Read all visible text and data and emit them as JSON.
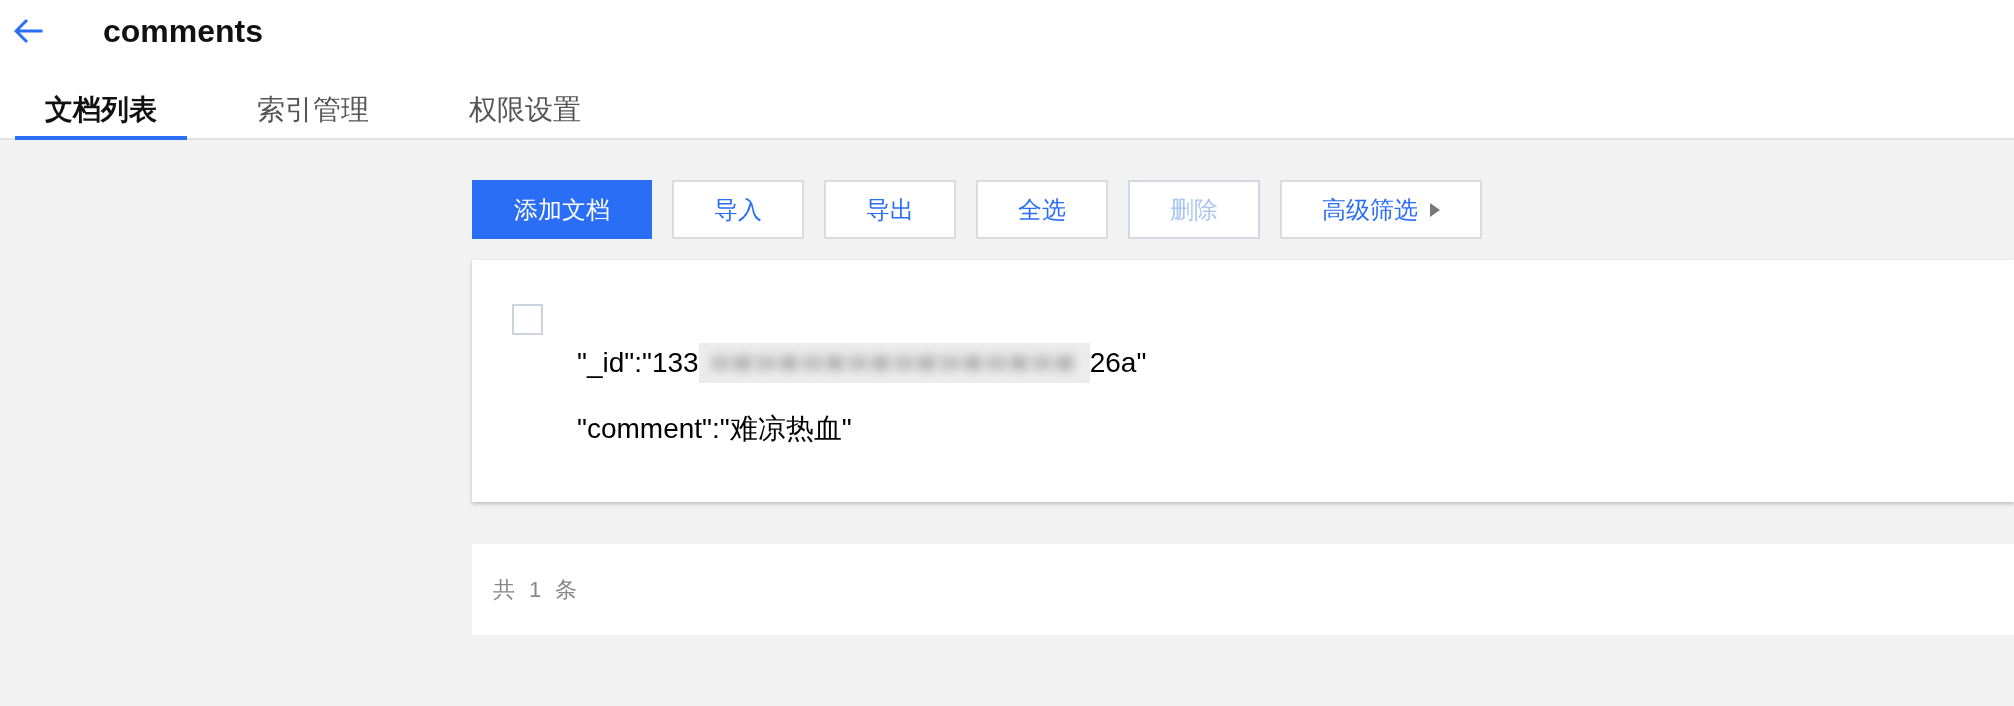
{
  "header": {
    "title": "comments"
  },
  "tabs": [
    {
      "label": "文档列表",
      "selected": true
    },
    {
      "label": "索引管理",
      "selected": false
    },
    {
      "label": "权限设置",
      "selected": false
    }
  ],
  "toolbar": {
    "buttons": [
      {
        "label": "添加文档",
        "kind": "primary",
        "disabled": false
      },
      {
        "label": "导入",
        "kind": "default",
        "disabled": false
      },
      {
        "label": "导出",
        "kind": "default",
        "disabled": false
      },
      {
        "label": "全选",
        "kind": "default",
        "disabled": false
      },
      {
        "label": "删除",
        "kind": "default",
        "disabled": true
      },
      {
        "label": "高级筛选",
        "kind": "dropdown",
        "disabled": false
      }
    ]
  },
  "documents": [
    {
      "checked": false,
      "fields": [
        {
          "kind": "redacted",
          "prefix": "\"_id\":\"133",
          "suffix": "26a\""
        },
        {
          "kind": "plain",
          "text": "\"comment\":\"难凉热血\""
        }
      ]
    }
  ],
  "pagination": {
    "summary": "共 1 条"
  }
}
